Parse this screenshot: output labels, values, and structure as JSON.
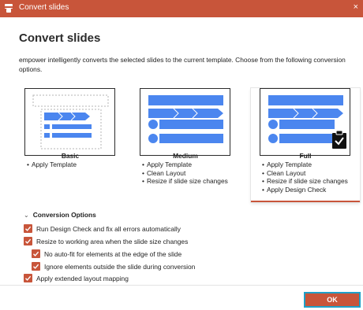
{
  "window": {
    "title": "Convert slides",
    "close_glyph": "×"
  },
  "dialog": {
    "heading": "Convert slides",
    "intro": "empower intelligently converts the selected slides to the current template. Choose from the following conversion options."
  },
  "cards": [
    {
      "id": "basic",
      "title": "Basic",
      "selected": false,
      "items": [
        "Apply Template"
      ]
    },
    {
      "id": "medium",
      "title": "Medium",
      "selected": false,
      "items": [
        "Apply Template",
        "Clean Layout",
        "Resize if slide size changes"
      ]
    },
    {
      "id": "full",
      "title": "Full",
      "selected": true,
      "items": [
        "Apply Template",
        "Clean Layout",
        "Resize if slide size changes",
        "Apply Design Check"
      ]
    }
  ],
  "conversion_options": {
    "header": "Conversion Options",
    "options": [
      {
        "label": "Run Design Check and fix all errors automatically",
        "checked": true
      },
      {
        "label": "Resize to working area when the slide size changes",
        "checked": true
      },
      {
        "label": "No auto-fit for elements at the edge of the slide",
        "checked": true
      },
      {
        "label": "Ignore elements outside the slide during conversion",
        "checked": true
      },
      {
        "label": "Apply extended layout mapping",
        "checked": true
      }
    ]
  },
  "buttons": {
    "ok": "OK"
  },
  "colors": {
    "accent": "#c8553a",
    "blue_shape": "#4b86ef",
    "focus_ring": "#1fa0c8"
  },
  "icons": {
    "app": "empower-app-icon",
    "check": "check-icon",
    "clipboard": "clipboard-check-icon",
    "chevron": "chevron-down-icon"
  }
}
